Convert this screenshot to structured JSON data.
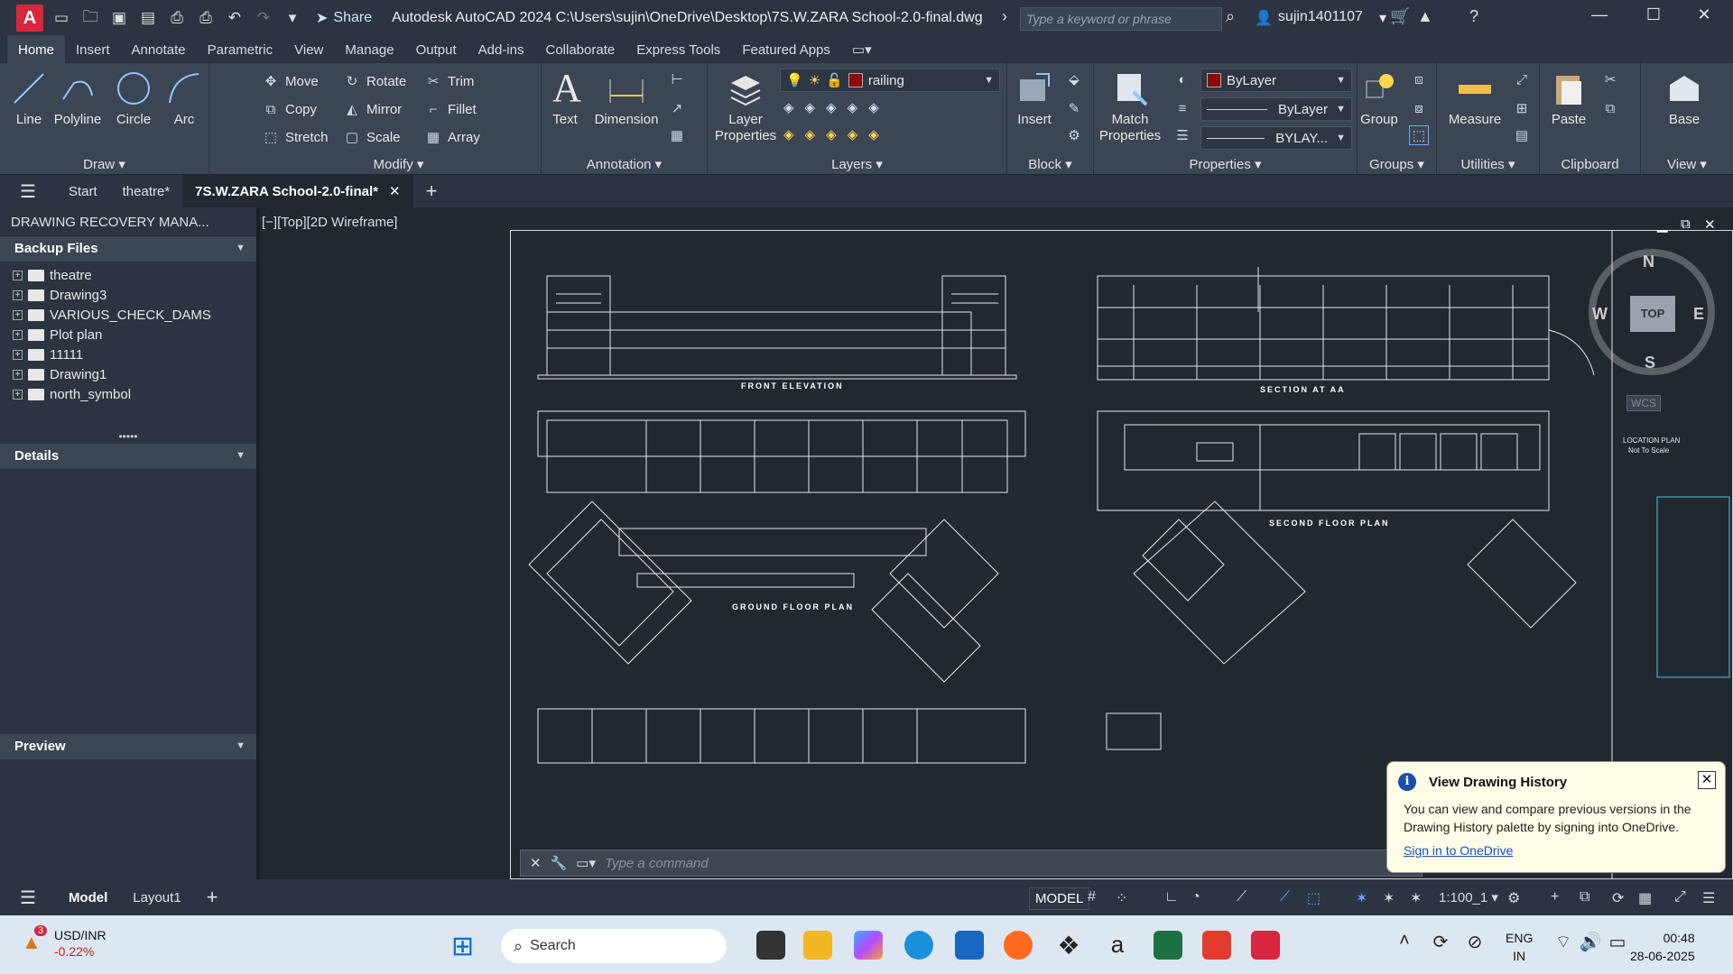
{
  "app": {
    "logo_letter": "A",
    "share_label": "Share",
    "title": "Autodesk AutoCAD 2024   C:\\Users\\sujin\\OneDrive\\Desktop\\7S.W.ZARA School-2.0-final.dwg",
    "search_placeholder": "Type a keyword or phrase",
    "username": "sujin1401107"
  },
  "ribbon_tabs": [
    "Home",
    "Insert",
    "Annotate",
    "Parametric",
    "View",
    "Manage",
    "Output",
    "Add-ins",
    "Collaborate",
    "Express Tools",
    "Featured Apps"
  ],
  "ribbon": {
    "draw": {
      "title": "Draw",
      "line": "Line",
      "polyline": "Polyline",
      "circle": "Circle",
      "arc": "Arc"
    },
    "modify": {
      "title": "Modify",
      "move": "Move",
      "rotate": "Rotate",
      "trim": "Trim",
      "copy": "Copy",
      "mirror": "Mirror",
      "fillet": "Fillet",
      "stretch": "Stretch",
      "scale": "Scale",
      "array": "Array"
    },
    "annotation": {
      "title": "Annotation",
      "text": "Text",
      "dimension": "Dimension"
    },
    "layers": {
      "title": "Layers",
      "layer_properties": "Layer Properties",
      "current_layer": "railing"
    },
    "block": {
      "title": "Block",
      "insert": "Insert"
    },
    "properties": {
      "title": "Properties",
      "match": "Match Properties",
      "color": "ByLayer",
      "linetype": "ByLayer",
      "lineweight": "BYLAY..."
    },
    "groups": {
      "title": "Groups",
      "group": "Group"
    },
    "utilities": {
      "title": "Utilities",
      "measure": "Measure"
    },
    "clipboard": {
      "title": "Clipboard",
      "paste": "Paste"
    },
    "view": {
      "title": "View",
      "base": "Base"
    }
  },
  "file_tabs": {
    "start": "Start",
    "tab1": "theatre*",
    "tab2": "7S.W.ZARA School-2.0-final*"
  },
  "palette": {
    "title": "DRAWING RECOVERY MANA...",
    "backup_header": "Backup Files",
    "files": [
      "theatre",
      "Drawing3",
      "VARIOUS_CHECK_DAMS",
      "Plot plan",
      "11111",
      "Drawing1",
      "north_symbol"
    ],
    "details_header": "Details",
    "preview_header": "Preview"
  },
  "viewport": {
    "label": "[−][Top][2D Wireframe]",
    "labels": {
      "front_elevation": "FRONT ELEVATION",
      "section": "SECTION AT AA",
      "ground_floor": "GROUND FLOOR PLAN",
      "second_floor": "SECOND FLOOR PLAN",
      "location_plan": "LOCATION PLAN",
      "not_to_scale": "Not To Scale"
    },
    "viewcube": {
      "n": "N",
      "s": "S",
      "e": "E",
      "w": "W",
      "top": "TOP",
      "wcs": "WCS"
    }
  },
  "command": {
    "placeholder": "Type a command"
  },
  "notification": {
    "title": "View Drawing History",
    "body": "You can view and compare previous versions in the Drawing History palette by signing into OneDrive.",
    "link": "Sign in to OneDrive"
  },
  "statusbar": {
    "model_tab": "Model",
    "layout_tab": "Layout1",
    "model_btn": "MODEL",
    "scale": "1:100_1"
  },
  "taskbar": {
    "ticker": "USD/INR",
    "change": "-0.22%",
    "badge": "3",
    "search": "Search",
    "lang1": "ENG",
    "lang2": "IN",
    "time": "00:48",
    "date": "28-06-2025"
  },
  "colors": {
    "accent": "#d7263d",
    "canvas": "#212830",
    "panel": "#3b4553",
    "link": "#1a4fc4"
  }
}
